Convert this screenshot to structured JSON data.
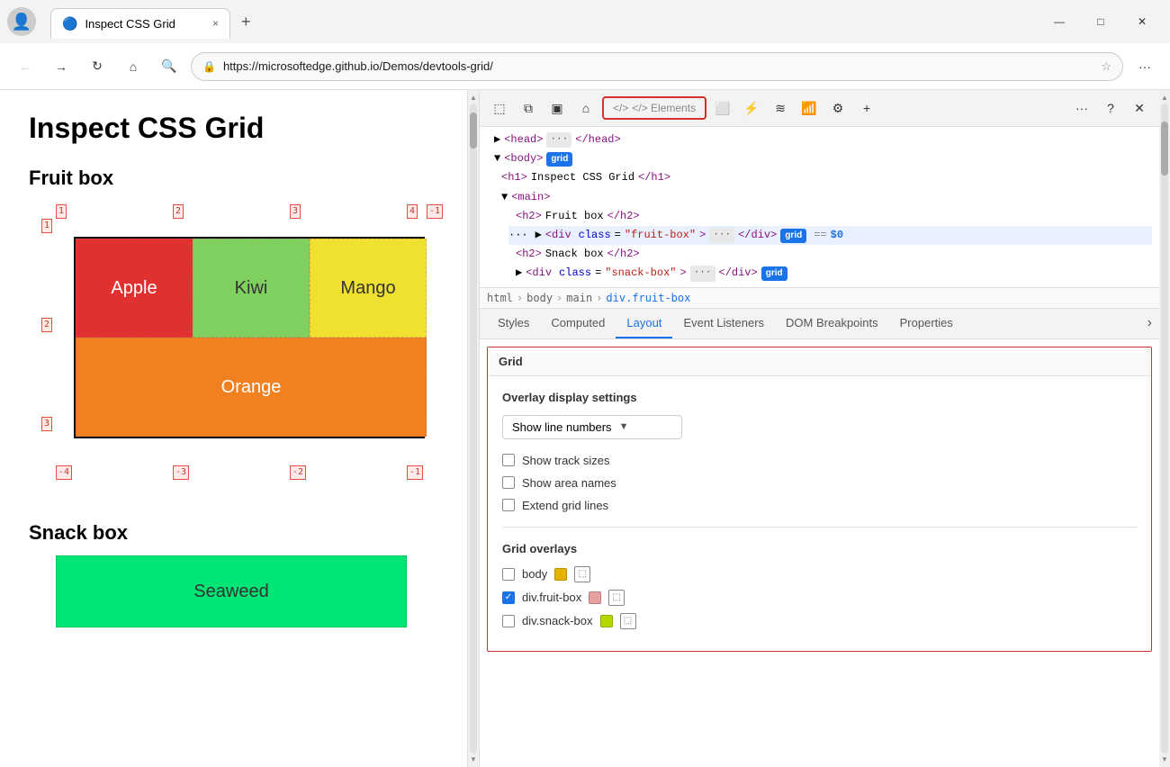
{
  "browser": {
    "title": "Inspect CSS Grid",
    "url": "https://microsoftedge.github.io/Demos/devtools-grid/",
    "tab_close": "×",
    "tab_new": "+",
    "win_minimize": "—",
    "win_maximize": "□",
    "win_close": "✕"
  },
  "webpage": {
    "page_title": "Inspect CSS Grid",
    "fruit_section": "Fruit box",
    "fruits": {
      "apple": "Apple",
      "kiwi": "Kiwi",
      "mango": "Mango",
      "orange": "Orange"
    },
    "snack_section": "Snack box",
    "seaweed": "Seaweed",
    "grid_numbers": {
      "col_top": [
        "1",
        "2",
        "3",
        "4"
      ],
      "col_bottom": [
        "-4",
        "-3",
        "-2",
        "-1"
      ],
      "row_left": [
        "1",
        "2",
        "3"
      ],
      "row_right": [
        "-1"
      ]
    }
  },
  "devtools": {
    "toolbar": {
      "elements_label": "</> Elements",
      "tools": [
        "inspect",
        "device",
        "toggle-sidebar",
        "home",
        "console",
        "network",
        "performance",
        "more",
        "help",
        "close"
      ]
    },
    "dom": {
      "lines": [
        {
          "indent": 0,
          "html": "<head>···</head>"
        },
        {
          "indent": 0,
          "html": "<body>",
          "badge": "grid"
        },
        {
          "indent": 1,
          "html": "<h1>Inspect CSS Grid</h1>"
        },
        {
          "indent": 1,
          "html": "<main>"
        },
        {
          "indent": 2,
          "html": "<h2>Fruit box</h2>"
        },
        {
          "indent": 2,
          "html": "· <div class=\"fruit-box\">···</div>",
          "badge": "grid",
          "selected": true,
          "dollar": "== $0"
        },
        {
          "indent": 2,
          "html": "<h2>Snack box</h2>"
        },
        {
          "indent": 2,
          "html": "▶ <div class=\"snack-box\">···</div>",
          "badge": "grid"
        }
      ]
    },
    "breadcrumbs": [
      "html",
      "body",
      "main",
      "div.fruit-box"
    ],
    "tabs": [
      "Styles",
      "Computed",
      "Layout",
      "Event Listeners",
      "DOM Breakpoints",
      "Properties"
    ],
    "active_tab": "Layout",
    "layout": {
      "grid_section_label": "Grid",
      "overlay_settings_label": "Overlay display settings",
      "dropdown_label": "Show line numbers",
      "checkboxes": [
        {
          "label": "Show track sizes",
          "checked": false
        },
        {
          "label": "Show area names",
          "checked": false
        },
        {
          "label": "Extend grid lines",
          "checked": false
        }
      ],
      "overlays_label": "Grid overlays",
      "overlay_items": [
        {
          "label": "body",
          "color": "#e6b300",
          "checked": false
        },
        {
          "label": "div.fruit-box",
          "color": "#e8a0a0",
          "checked": true
        },
        {
          "label": "div.snack-box",
          "color": "#b3d900",
          "checked": false
        }
      ]
    }
  }
}
